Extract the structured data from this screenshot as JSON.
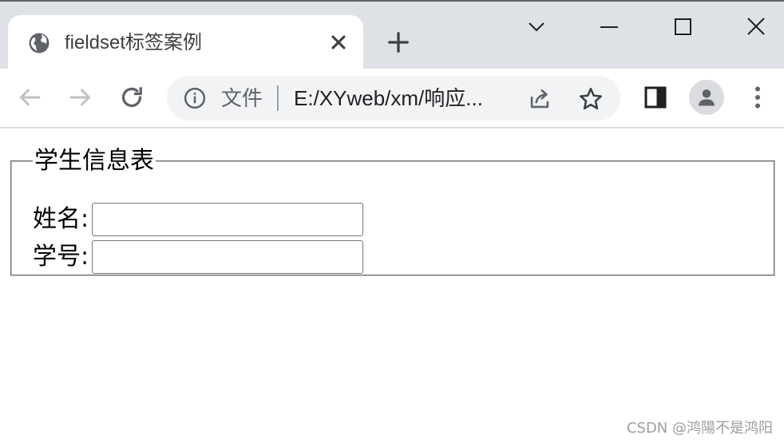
{
  "browser": {
    "tab": {
      "title": "fieldset标签案例",
      "icon": "globe-icon"
    },
    "window_controls": [
      "chevron-down-icon",
      "minimize-icon",
      "maximize-icon",
      "close-icon"
    ],
    "omnibox": {
      "security_label": "文件",
      "url": "E:/XYweb/xm/响应..."
    },
    "accent": "#dee1e6"
  },
  "page": {
    "fieldset": {
      "legend": "学生信息表",
      "fields": [
        {
          "label": "姓名:",
          "value": ""
        },
        {
          "label": "学号:",
          "value": ""
        }
      ]
    }
  },
  "watermark": "CSDN @鸿陽不是鸿阳"
}
